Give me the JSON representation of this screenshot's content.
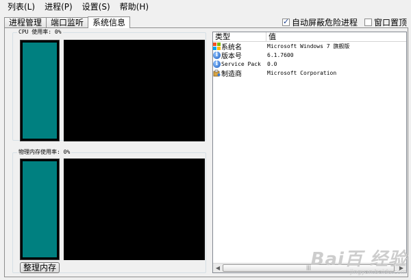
{
  "menu": [
    "列表(L)",
    "进程(P)",
    "设置(S)",
    "帮助(H)"
  ],
  "tabs": [
    {
      "label": "进程管理",
      "active": false
    },
    {
      "label": "端口监听",
      "active": false
    },
    {
      "label": "系统信息",
      "active": true
    }
  ],
  "options": [
    {
      "label": "自动屏蔽危险进程",
      "checked": true
    },
    {
      "label": "窗口置顶",
      "checked": false
    }
  ],
  "cpu": {
    "label": "CPU 使用率: 0%",
    "usage_percent": 0
  },
  "memory": {
    "label": "物理内存使用率: 0%",
    "usage_percent": 0
  },
  "buttons": {
    "clean_memory": "整理内存"
  },
  "sysinfo": {
    "columns": [
      "类型",
      "值"
    ],
    "rows": [
      {
        "type": "系统名",
        "value": "Microsoft Windows 7 旗舰版",
        "icon": "windows-logo-icon"
      },
      {
        "type": "版本号",
        "value": "6.1.7600",
        "icon": "info-icon"
      },
      {
        "type": "Service Pack",
        "value": "0.0",
        "icon": "info-icon"
      },
      {
        "type": "制造商",
        "value": "Microsoft Corporation",
        "icon": "manufacturer-icon"
      }
    ]
  },
  "watermark": {
    "main": "Bai百 经验",
    "sub": "jingyan.baidu.com"
  },
  "colors": {
    "meter_fill": "#008080",
    "graph_bg": "#000000"
  }
}
